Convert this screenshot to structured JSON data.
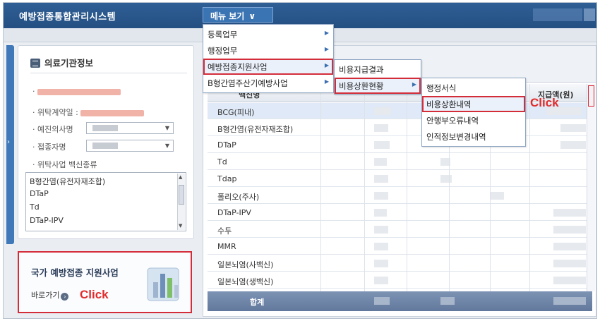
{
  "header": {
    "app_title": "예방접종통합관리시스템",
    "menu_button": "메뉴 보기",
    "menu_chevron": "chevron-down-icon"
  },
  "left_panel": {
    "title": "의료기관정보",
    "contract_date_label": "· 위탁계약일 :",
    "doctor_label": "· 예진의사명",
    "recipient_label": "· 접종자명",
    "vaccine_types_label": "· 위탁사업 백신종류",
    "vaccine_list": [
      "B형간염(유전자재조합)",
      "DTaP",
      "Td",
      "DTaP-IPV"
    ]
  },
  "promo": {
    "title": "국가 예방접종 지원사업",
    "link": "바로가기",
    "click": "Click"
  },
  "menu1": {
    "items": [
      "등록업무",
      "행정업무",
      "예방접종지원사업",
      "B형간염주산기예방사업"
    ]
  },
  "menu2": {
    "items": [
      "비용지급결과",
      "비용상환현황"
    ]
  },
  "menu3": {
    "items": [
      "행정서식",
      "비용상환내역",
      "안행부오류내역",
      "인적정보변경내역"
    ],
    "click": "Click"
  },
  "grid": {
    "header_left": "백신명",
    "header_right": "지급액(원)",
    "rows": [
      "BCG(피내)",
      "B형간염(유전자재조합)",
      "DTaP",
      "Td",
      "Tdap",
      "폴리오(주사)",
      "DTaP-IPV",
      "수두",
      "MMR",
      "일본뇌염(사백신)",
      "일본뇌염(생백신)"
    ],
    "footer": "합계"
  },
  "colors": {
    "accent": "#2f5f96",
    "highlight_red": "#d42d3a",
    "click_red": "#e12b2b"
  }
}
